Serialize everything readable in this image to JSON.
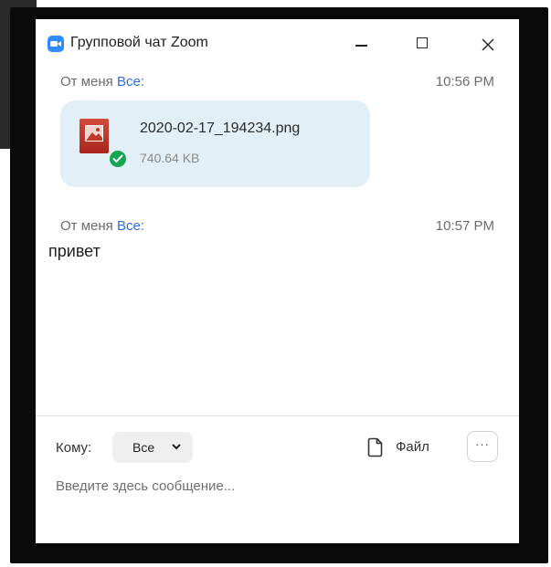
{
  "window": {
    "title": "Групповой чат Zoom",
    "app_icon": "zoom-camera-icon",
    "controls": {
      "minimize_icon": "minimize-icon",
      "maximize_icon": "maximize-icon",
      "close_icon": "close-icon"
    }
  },
  "messages": [
    {
      "from": "От меня",
      "to": "Все:",
      "time": "10:56 PM",
      "type": "file",
      "file": {
        "name": "2020-02-17_194234.png",
        "size": "740.64 KB",
        "icon": "image-file-icon",
        "status_icon": "check-circle-icon"
      }
    },
    {
      "from": "От меня",
      "to": "Все:",
      "time": "10:57 PM",
      "type": "text",
      "text": "привет"
    }
  ],
  "composer": {
    "to_label": "Кому:",
    "recipient": "Все",
    "recipient_icon": "chevron-down-icon",
    "file_button_label": "Файл",
    "file_icon": "file-icon",
    "more_icon": "more-icon",
    "more_label": "···",
    "input_placeholder": "Введите здесь сообщение...",
    "input_value": ""
  },
  "colors": {
    "accent": "#2d8cff",
    "link": "#2d6cdf",
    "file_bubble": "#e3eff7",
    "success": "#12a64f",
    "frame": "#0a0a0a"
  }
}
